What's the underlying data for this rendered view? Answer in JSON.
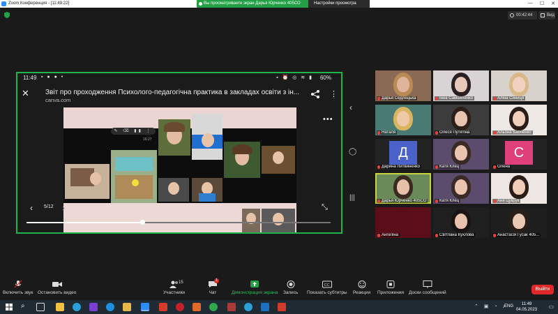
{
  "window": {
    "title": "Zoom Конференция - [11:49:22]",
    "share_banner": "Вы просматриваете экран Дарья Юрченко 405СО",
    "view_options": "Настройки просмотра",
    "controls": [
      "—",
      "☐",
      "✕"
    ]
  },
  "meeting": {
    "timer": "00:42:44",
    "view_label": "Вид"
  },
  "phone": {
    "time": "11:49",
    "battery": "60%",
    "doc_title": "Звіт про проходження Психолого-педагогічна практика в закладах освіти з ін...",
    "doc_url": "canva.com",
    "page_indicator": "5/12",
    "slide_time": "16:27",
    "progress": 0.38
  },
  "participants": [
    {
      "name": "Дарья Седлецька",
      "bg": "#8a6a55",
      "face": "#e0b49a",
      "hair": "#b88a55"
    },
    {
      "name": "Інна Самойленко",
      "bg": "#d8d4d6",
      "face": "#e8c8b8",
      "hair": "#2a2022"
    },
    {
      "name": "Аліна Синиця",
      "bg": "#d7d2cc",
      "face": "#f0d2c0",
      "hair": "#d9b98a"
    },
    {
      "name": "Наталя",
      "bg": "#4a7a74",
      "face": "#efc8a8",
      "hair": "#d9b560"
    },
    {
      "name": "Олеся Путятіна",
      "bg": "#3c3c3c",
      "face": "#e7c4b0",
      "hair": "#2c1f1a"
    },
    {
      "name": "Альона Бабченко",
      "bg": "#efe9e6",
      "face": "#f0d0bc",
      "hair": "#2a1d18"
    },
    {
      "name": "Дарина Литвиненко",
      "letter": "Д",
      "bg": "#232323",
      "box": "#4a62c9"
    },
    {
      "name": "Катя Клец",
      "bg": "#5b4b6c",
      "face": "#eac4b0",
      "hair": "#3a2a26"
    },
    {
      "name": "Олена",
      "letter": "С",
      "bg": "#232323",
      "box": "#e0407a"
    },
    {
      "name": "Дарья Юрченко 405СО",
      "bg": "#6a8a5a",
      "face": "#e6c0a8",
      "hair": "#3a2a20",
      "active": true
    },
    {
      "name": "Катя Клец",
      "bg": "#5b4b6c",
      "face": "#eac4b0",
      "hair": "#3a2a26"
    },
    {
      "name": "Аня Цукрук",
      "bg": "#ede6e2",
      "face": "#f0cdb8",
      "hair": "#2a1c16"
    },
    {
      "name": "Ангеліна",
      "bg": "#5a0e1a",
      "face": "#5a0e1a",
      "hair": "#5a0e1a"
    },
    {
      "name": "Світлана Кухлова",
      "bg": "#1f1f1f",
      "face": "#e8c2ae",
      "hair": "#1a1412"
    },
    {
      "name": "Анастасія Гусак 405...",
      "bg": "#1e1e1e",
      "face": "#e9c8b4",
      "hair": "#2a1e18"
    }
  ],
  "toolbar": {
    "mute": "Включить звук",
    "video": "Остановить видео",
    "participants": "Участники",
    "participants_count": "15",
    "chat": "Чат",
    "chat_badge": "1",
    "share": "Демонстрация экрана",
    "record": "Запись",
    "captions": "Показать субтитры",
    "reactions": "Реакции",
    "apps": "Приложения",
    "whiteboard": "Доски сообщений",
    "end": "Выйти"
  },
  "taskbar": {
    "time": "11:49",
    "date": "04.05.2023",
    "lang": "ENG"
  },
  "colors": {
    "accent_green": "#1db44b",
    "share_green": "#23a045",
    "end_red": "#e02828",
    "active_tile": "#c8d63a"
  }
}
